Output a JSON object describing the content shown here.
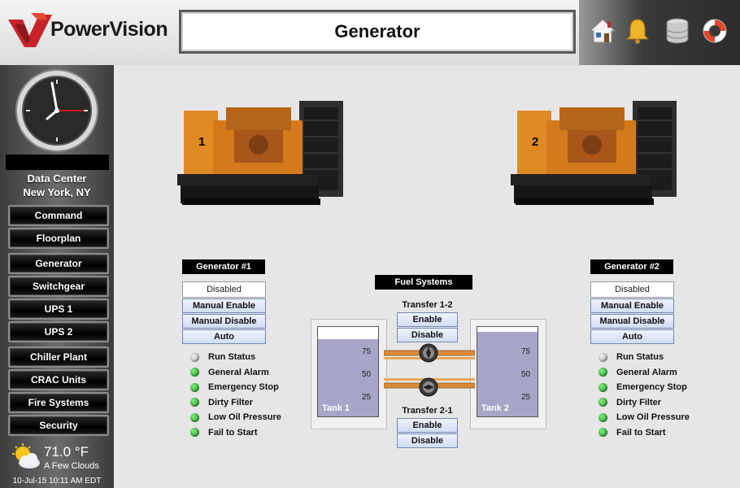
{
  "header": {
    "logo_text": "PowerVision",
    "title": "Generator",
    "icons": [
      "home-icon",
      "bell-icon",
      "database-icon",
      "lifebuoy-icon"
    ]
  },
  "sidebar": {
    "location_line1": "Data Center",
    "location_line2": "New York, NY",
    "nav": [
      "Command",
      "Floorplan",
      "Generator",
      "Switchgear",
      "UPS 1",
      "UPS 2",
      "Chiller Plant",
      "CRAC Units",
      "Fire Systems",
      "Security"
    ],
    "weather": {
      "temp": "71.0 °F",
      "condition": "A Few Clouds",
      "icon": "partly-cloudy-icon"
    },
    "datetime": "10-Jul-15 10:11 AM EDT"
  },
  "generators": [
    {
      "number": "1",
      "label": "Generator #1",
      "mode_status": "Disabled",
      "buttons": [
        "Manual Enable",
        "Manual Disable",
        "Auto"
      ],
      "status": [
        {
          "label": "Run Status",
          "state": "off"
        },
        {
          "label": "General Alarm",
          "state": "ok"
        },
        {
          "label": "Emergency Stop",
          "state": "ok"
        },
        {
          "label": "Dirty Filter",
          "state": "ok"
        },
        {
          "label": "Low Oil Pressure",
          "state": "ok"
        },
        {
          "label": "Fail to Start",
          "state": "ok"
        }
      ]
    },
    {
      "number": "2",
      "label": "Generator #2",
      "mode_status": "Disabled",
      "buttons": [
        "Manual Enable",
        "Manual Disable",
        "Auto"
      ],
      "status": [
        {
          "label": "Run Status",
          "state": "off"
        },
        {
          "label": "General Alarm",
          "state": "ok"
        },
        {
          "label": "Emergency Stop",
          "state": "ok"
        },
        {
          "label": "Dirty Filter",
          "state": "ok"
        },
        {
          "label": "Low Oil Pressure",
          "state": "ok"
        },
        {
          "label": "Fail to Start",
          "state": "ok"
        }
      ]
    }
  ],
  "fuel": {
    "title": "Fuel Systems",
    "transfer_1_2": {
      "title": "Transfer 1-2",
      "enable": "Enable",
      "disable": "Disable"
    },
    "transfer_2_1": {
      "title": "Transfer 2-1",
      "enable": "Enable",
      "disable": "Disable"
    },
    "tank_ticks": [
      "75",
      "50",
      "25"
    ],
    "tanks": [
      {
        "name": "Tank 1",
        "level_percent": 86
      },
      {
        "name": "Tank 2",
        "level_percent": 95
      }
    ]
  },
  "colors": {
    "ok": "#2ea336",
    "off": "#b5b5b5",
    "tank_fill": "#a8a6c8",
    "button_border": "#7287b8",
    "pipe": "#d98a3a"
  }
}
